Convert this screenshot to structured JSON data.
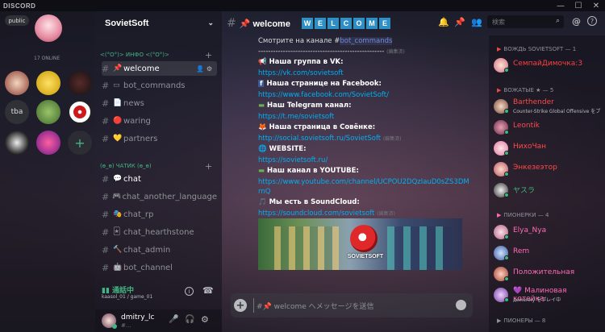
{
  "app": {
    "title": "DISCORD"
  },
  "window_controls": {
    "minimize": "—",
    "maximize": "☐",
    "close": "✕"
  },
  "servers": {
    "public_label": "public",
    "online_text": "17 ONLINE",
    "tba_label": "tba"
  },
  "guild": {
    "name": "SovietSoft",
    "chevron": "⌄"
  },
  "categories": [
    {
      "label": "<(°O°)> ИНФО <(°O°)>"
    },
    {
      "label": "(ɵ_ɵ) ЧАТИК (ɵ_ɵ)"
    }
  ],
  "channels": [
    {
      "emoji": "📌",
      "name": "welcome"
    },
    {
      "emoji": "▭",
      "name": "bot_commands"
    },
    {
      "emoji": "📄",
      "name": "news"
    },
    {
      "emoji": "🔴",
      "name": "waring"
    },
    {
      "emoji": "💛",
      "name": "partners"
    },
    {
      "emoji": "💬",
      "name": "chat"
    },
    {
      "emoji": "🎮",
      "name": "chat_another_language"
    },
    {
      "emoji": "🎭",
      "name": "chat_rp"
    },
    {
      "emoji": "🃏",
      "name": "chat_hearthstone"
    },
    {
      "emoji": "🔨",
      "name": "chat_admin"
    },
    {
      "emoji": "🤖",
      "name": "bot_channel"
    }
  ],
  "voice": {
    "status": "通話中",
    "location": "kaasol_01 / game_01"
  },
  "user": {
    "name": "dmitry_lc",
    "tag": "#..."
  },
  "chat_header": {
    "hash": "#",
    "channel_name": "📌 welcome",
    "welcome_letters": [
      "W",
      "E",
      "L",
      "C",
      "O",
      "M",
      "E"
    ]
  },
  "header_icons": {
    "bell": "🔔",
    "pin": "📌",
    "members": "👥",
    "at": "@",
    "help": "?"
  },
  "search": {
    "placeholder": "検索"
  },
  "messages": {
    "intro": "Смотрите на канале #",
    "intro_channel": "bot_commands",
    "divider": "---------------------------------------------------",
    "edited_label": "(編集済)",
    "vk_title": "Наша группа в VK:",
    "vk_link": "https://vk.com/sovietsoft",
    "fb_title": "Наша странице на Facebook:",
    "fb_link": "https://www.facebook.com/SovietSoft/",
    "tg_title": "Наш Telegram канал:",
    "tg_link": "https://t.me/sovietsoft",
    "sovenok_title": "Наша страница в Совёнке:",
    "sovenok_link": "http://social.sovietsoft.ru/SovietSoft",
    "web_title": "WEBSITE:",
    "web_link": "https://sovietsoft.ru/",
    "yt_title": "Наш канал в YOUTUBE:",
    "yt_link_1": "https://www.youtube.com/channel/UCPOU2DQzIauD0sZS3DM",
    "yt_link_2": "rnQ",
    "sc_title": "Мы есть в SoundCloud:",
    "sc_link": "https://soundcloud.com/sovietsoft",
    "banner_text": "SOVIETSOFT"
  },
  "message_input": {
    "placeholder": "#📌 welcome へメッセージを送信"
  },
  "members": {
    "roles": [
      {
        "label": "ВОЖДЬ SOVIETSOFT — 1"
      },
      {
        "label": "ВОЖАТЫЕ ★ — 5"
      },
      {
        "label": "ПИОНЕРКИ — 4"
      },
      {
        "label": "ПИОНЕРЫ — 8"
      }
    ],
    "list": [
      {
        "name": "СемпайДимочка:3",
        "color": "#ff4040",
        "sub": ""
      },
      {
        "name": "Barthender",
        "color": "#ff4a4a",
        "sub": "Counter-Strike Global Offensive をプ"
      },
      {
        "name": "Leontik",
        "color": "#ff4a4a",
        "sub": ""
      },
      {
        "name": "НихоЧан",
        "color": "#ff4a4a",
        "sub": ""
      },
      {
        "name": "Энкезеэтор",
        "color": "#ff4a4a",
        "sub": ""
      },
      {
        "name": "ヤスラ",
        "color": "#43b581",
        "sub": ""
      },
      {
        "name": "Elya_Nya",
        "color": "#ff6bb5",
        "sub": ""
      },
      {
        "name": "Rem",
        "color": "#ff6bb5",
        "sub": ""
      },
      {
        "name": "Положительная",
        "color": "#ff6bb5",
        "sub": ""
      },
      {
        "name": "💜 Малиновая котейка...",
        "color": "#ff6bb5",
        "sub": "деменку をプレイ中"
      }
    ]
  },
  "colors": {
    "accent": "#2d8fc4",
    "link": "#00b0f4",
    "online": "#43b581",
    "leader": "#ff4040"
  }
}
